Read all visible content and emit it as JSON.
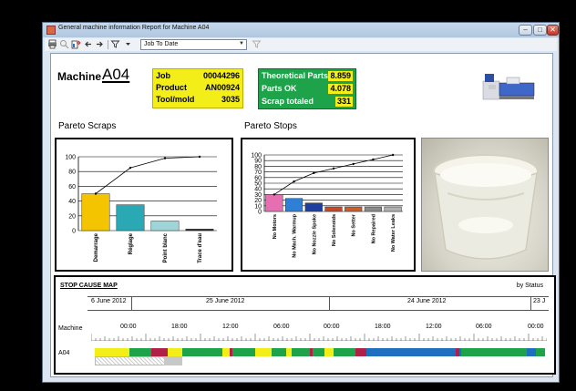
{
  "window": {
    "title": "General machine information Report for Machine A04",
    "controls": {
      "minimize": "–",
      "maximize": "□",
      "close": "✕"
    }
  },
  "toolbar": {
    "icons": [
      "print-icon",
      "print-preview-icon",
      "export-icon",
      "back-arrow-icon",
      "forward-arrow-icon",
      "filter-icon",
      "dropdown-caret-icon",
      "clear-filter-icon"
    ],
    "period_select": "Job To Date"
  },
  "machine": {
    "label": "Machine",
    "id": "A04"
  },
  "job_info": {
    "job_label": "Job",
    "job_value": "00044296",
    "product_label": "Product",
    "product_value": "AN00924",
    "tool_label": "Tool/mold",
    "tool_value": "3035"
  },
  "parts_info": {
    "theoretical_label": "Theoretical Parts",
    "theoretical_value": "8.859",
    "ok_label": "Parts OK",
    "ok_value": "4.078",
    "scrap_label": "Scrap totaled",
    "scrap_value": "331"
  },
  "pareto_scraps": {
    "title": "Pareto Scraps",
    "chart_data": {
      "type": "bar",
      "categories": [
        "Demarrage",
        "Réglage",
        "Point blanc",
        "Trace d'eau"
      ],
      "values": [
        50,
        35,
        13,
        2
      ],
      "cumulative": [
        50,
        85,
        98,
        100
      ],
      "colors": [
        "#f5c400",
        "#2aa9b5",
        "#9fd5d8",
        "#222222"
      ],
      "yticks": [
        "0",
        "20",
        "40",
        "60",
        "80",
        "100"
      ],
      "ylim": [
        0,
        100
      ]
    }
  },
  "pareto_stops": {
    "title": "Pareto Stops",
    "chart_data": {
      "type": "bar",
      "categories": [
        "No Motors",
        "No Mach. Warmup",
        "No Nozzle Spoke",
        "No Solenoids",
        "No Setter",
        "No Repaired",
        "No Water Leaks"
      ],
      "values": [
        30,
        23,
        15,
        8,
        8,
        8,
        8
      ],
      "cumulative": [
        30,
        53,
        68,
        76,
        84,
        92,
        100
      ],
      "colors": [
        "#e66fb2",
        "#2f7fd4",
        "#1f3f9f",
        "#c44a2a",
        "#c7602f",
        "#8a8a8a",
        "#b0b0b0"
      ],
      "yticks": [
        "0",
        "10",
        "20",
        "30",
        "40",
        "50",
        "60",
        "70",
        "80",
        "90",
        "100"
      ],
      "ylim": [
        0,
        100
      ]
    }
  },
  "stop_cause_map": {
    "title": "STOP CAUSE MAP",
    "by_status": "by Status",
    "dates": [
      "6 June 2012",
      "25 June 2012",
      "24 June 2012",
      "23 J"
    ],
    "machine_row_label": "Machine",
    "machine_value": "A04",
    "time_labels": [
      "00:00",
      "18:00",
      "12:00",
      "06:00",
      "00:00",
      "18:00",
      "12:00",
      "06:00",
      "00:00"
    ],
    "status_colors": {
      "running": "#1fa34a",
      "stopped": "#f3ee18",
      "fault": "#b0214a",
      "setup": "#1f6fc0",
      "idle": "#c8c8c8"
    }
  }
}
